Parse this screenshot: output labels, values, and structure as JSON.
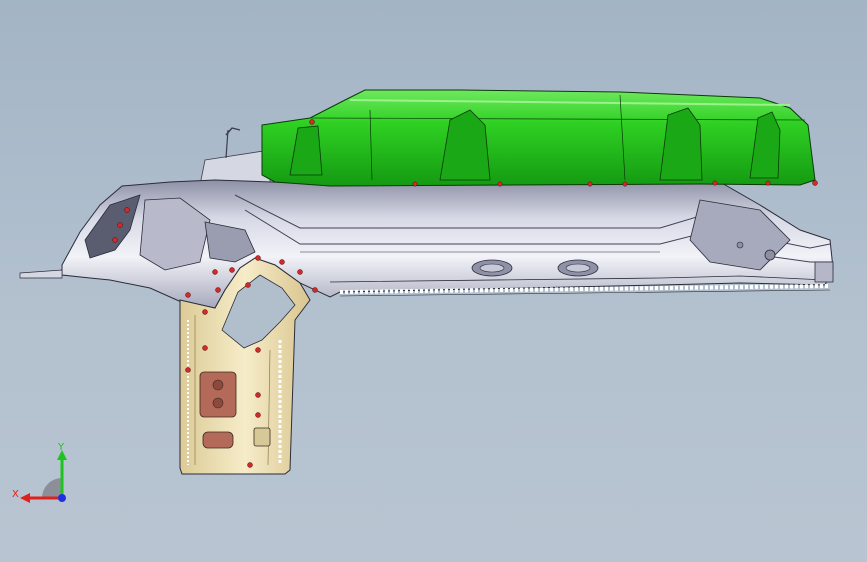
{
  "viewport": {
    "background_top": "#a3b4c5",
    "background_bottom": "#b8c4d1"
  },
  "model": {
    "colors": {
      "green_panel": "#22c41a",
      "green_dark": "#139010",
      "gray_frame": "#c7c9d8",
      "gray_dark": "#7d7f92",
      "tan_pillar": "#efe1b3",
      "tan_dark": "#c9b27a",
      "weld_point": "#d12a2a",
      "brown_pad": "#b46a58"
    }
  },
  "triad": {
    "x_label": "X",
    "y_label": "Y",
    "x_color": "#e0201a",
    "y_color": "#1ec41e",
    "z_color": "#2030e0"
  }
}
